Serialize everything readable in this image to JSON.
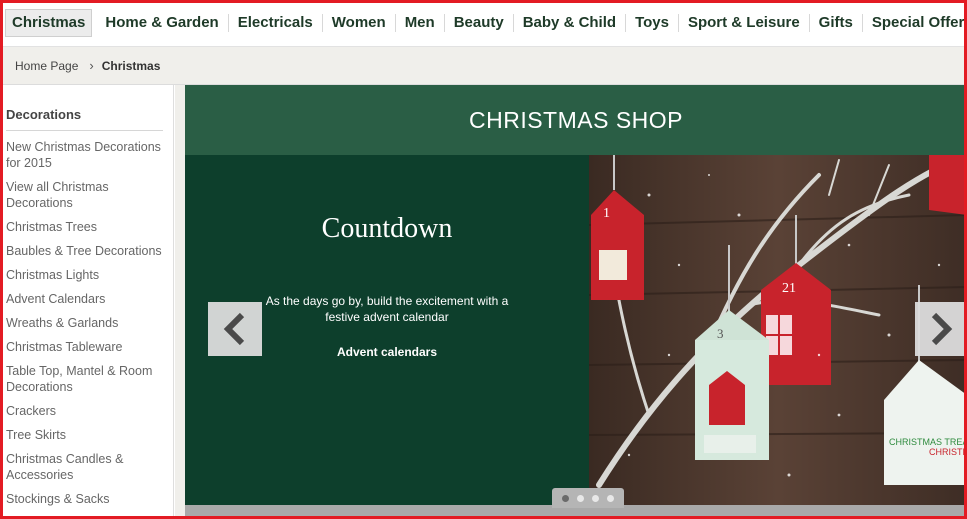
{
  "topnav": {
    "items": [
      {
        "label": "Christmas",
        "active": true
      },
      {
        "label": "Home & Garden"
      },
      {
        "label": "Electricals"
      },
      {
        "label": "Women"
      },
      {
        "label": "Men"
      },
      {
        "label": "Beauty"
      },
      {
        "label": "Baby & Child"
      },
      {
        "label": "Toys"
      },
      {
        "label": "Sport & Leisure"
      },
      {
        "label": "Gifts"
      },
      {
        "label": "Special Offers"
      }
    ]
  },
  "breadcrumb": {
    "home": "Home Page",
    "separator": "›",
    "current": "Christmas"
  },
  "sidebar": {
    "heading": "Decorations",
    "links": [
      "New Christmas Decorations for 2015",
      "View all Christmas Decorations",
      "Christmas Trees",
      "Baubles & Tree Decorations",
      "Christmas Lights",
      "Advent Calendars",
      "Wreaths & Garlands",
      "Christmas Tableware",
      "Table Top, Mantel & Room Decorations",
      "Crackers",
      "Tree Skirts",
      "Christmas Candles & Accessories",
      "Stockings & Sacks"
    ]
  },
  "banner": {
    "title": "CHRISTMAS SHOP",
    "slide": {
      "heading": "Countdown",
      "text": "As the days go by, build the excitement with a festive advent calendar",
      "link": "Advent calendars",
      "house_numbers": [
        "1",
        "3",
        "21"
      ],
      "box_text_1": "CHRISTMAS TREATS",
      "box_text_2": "CHRISTMAS TREATS"
    },
    "carousel": {
      "count": 4,
      "active_index": 0
    }
  },
  "colors": {
    "nav_text": "#1e3a28",
    "banner_title_bg": "#2a5e45",
    "slide_bg": "#0d3f2c",
    "frame": "#e31b23"
  },
  "icons": {
    "prev": "chevron-left-icon",
    "next": "chevron-right-icon"
  }
}
